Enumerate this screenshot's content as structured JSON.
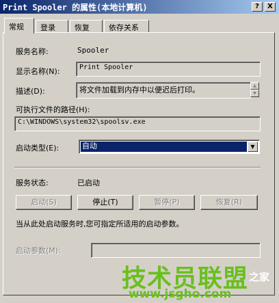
{
  "window": {
    "title": "Print Spooler 的属性(本地计算机)",
    "help_glyph": "?",
    "close_glyph": "X"
  },
  "tabs": [
    {
      "label": "常规"
    },
    {
      "label": "登录"
    },
    {
      "label": "恢复"
    },
    {
      "label": "依存关系"
    }
  ],
  "general": {
    "service_name_label": "服务名称:",
    "service_name_value": "Spooler",
    "display_name_label": "显示名称(N):",
    "display_name_value": "Print Spooler",
    "description_label": "描述(D):",
    "description_value": "将文件加载到内存中以便迟后打印。",
    "path_label": "可执行文件的路径(H):",
    "path_value": "C:\\WINDOWS\\system32\\spoolsv.exe",
    "startup_type_label": "启动类型(E):",
    "startup_type_value": "自动",
    "status_label": "服务状态:",
    "status_value": "已启动",
    "buttons": {
      "start": "启动(S)",
      "stop": "停止(T)",
      "pause": "暂停(P)",
      "resume": "恢复(R)"
    },
    "hint": "当从此处启动服务时,您可指定所适用的启动参数。",
    "start_params_label": "启动参数(M):",
    "start_params_value": ""
  },
  "watermark": {
    "brand": "技术员联盟",
    "suffix": "之家",
    "url": "www.jsgho.com"
  }
}
